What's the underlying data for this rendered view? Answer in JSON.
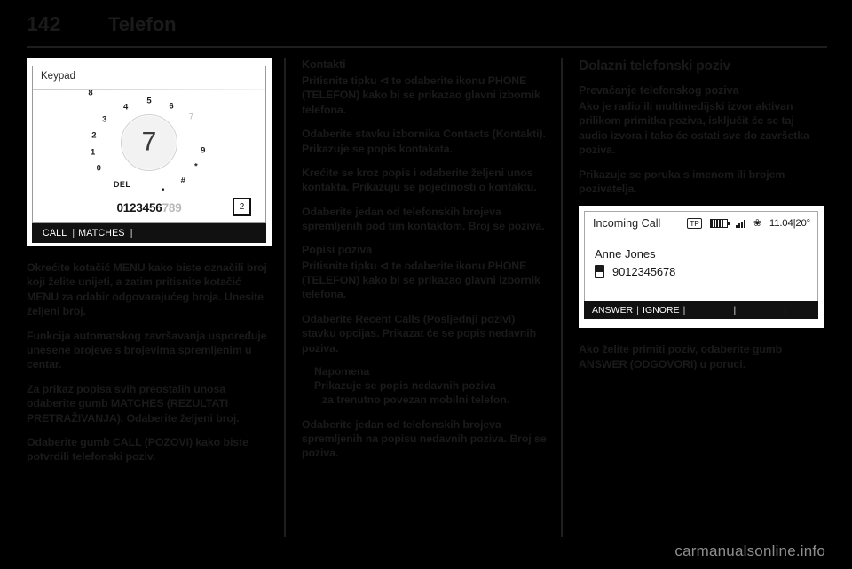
{
  "header": {
    "page_number": "142",
    "chapter": "Telefon"
  },
  "figure_keypad": {
    "screen_title": "Keypad",
    "dial_selected": "7",
    "dial_ring": [
      {
        "label": "DEL",
        "dim": false
      },
      {
        "label": "0",
        "dim": false
      },
      {
        "label": "1",
        "dim": false
      },
      {
        "label": "2",
        "dim": false
      },
      {
        "label": "3",
        "dim": false
      },
      {
        "label": "4",
        "dim": false
      },
      {
        "label": "5",
        "dim": false
      },
      {
        "label": "6",
        "dim": false
      },
      {
        "label": "7",
        "dim": true
      },
      {
        "label": "8",
        "dim": false
      },
      {
        "label": "9",
        "dim": false
      },
      {
        "label": "*",
        "dim": false
      },
      {
        "label": "#",
        "dim": false
      },
      {
        "label": "•",
        "dim": false
      }
    ],
    "entered_digits": "0123456",
    "pending_digits": "789",
    "match_badge": "2",
    "softkeys": [
      "CALL",
      "MATCHES"
    ]
  },
  "figure_call": {
    "status_title": "Incoming Call",
    "tp_badge": "TP",
    "clock": "11.04",
    "temperature": "20°",
    "caller_name": "Anne Jones",
    "caller_number": "9012345678",
    "softkeys": [
      "ANSWER",
      "IGNORE"
    ]
  },
  "column1": {
    "paragraphs": [
      "Okrećite kotačić MENU kako biste označili broj koji želite unijeti, a zatim pritisnite kotačić MENU za odabir odgovarajućeg broja. Unesite željeni broj.",
      "Funkcija automatskog završavanja uspoređuje unesene brojeve s brojevima spremljenim u centar.",
      "Za prikaz popisa svih preostalih unosa odaberite gumb MATCHES (REZULTATI PRETRAŽIVANJA). Odaberite željeni broj.",
      "Odaberite gumb CALL (POZOVI) kako biste potvrdili telefonski poziv."
    ]
  },
  "column2": {
    "heading": "Kontakti",
    "paragraphs_top": [
      "Pritisnite tipku ⊲ te odaberite ikonu PHONE (TELEFON) kako bi se prikazao glavni izbornik telefona.",
      "Odaberite stavku izbornika Contacts (Kontakti). Prikazuje se popis kontakata.",
      "Krećite se kroz popis i odaberite željeni unos kontakta. Prikazuju se pojedinosti o kontaktu.",
      "Odaberite jedan od telefonskih brojeva spremljenih pod tim kontaktom. Broj se poziva."
    ],
    "heading2": "Popisi poziva",
    "paragraphs_mid": [
      "Pritisnite tipku ⊲ te odaberite ikonu PHONE (TELEFON) kako bi se prikazao glavni izbornik telefona.",
      "Odaberite Recent Calls (Posljednji pozivi) stavku opcijas. Prikazat će se popis nedavnih poziva."
    ],
    "note": {
      "title": "Napomena",
      "line1": "Prikazuje se popis nedavnih poziva",
      "line2": "za trenutno povezan mobilni telefon."
    },
    "paragraphs_bottom": [
      "Odaberite jedan od telefonskih brojeva spremljenih na popisu nedavnih poziva. Broj se poziva."
    ]
  },
  "column3": {
    "heading": "Dolazni telefonski poziv",
    "subheading": "Prevaćanje telefonskog poziva",
    "paragraphs_top": [
      "Ako je radio ili multimedijski izvor aktivan prilikom primitka poziva, isključit će se taj audio izvora i tako će ostati sve do završetka poziva.",
      "Prikazuje se poruka s imenom ili brojem pozivatelja."
    ],
    "paragraphs_bottom": [
      "Ako želite primiti poziv, odaberite gumb ANSWER (ODGOVORI) u poruci."
    ]
  },
  "footer": {
    "watermark": "carmanualsonline.info"
  }
}
